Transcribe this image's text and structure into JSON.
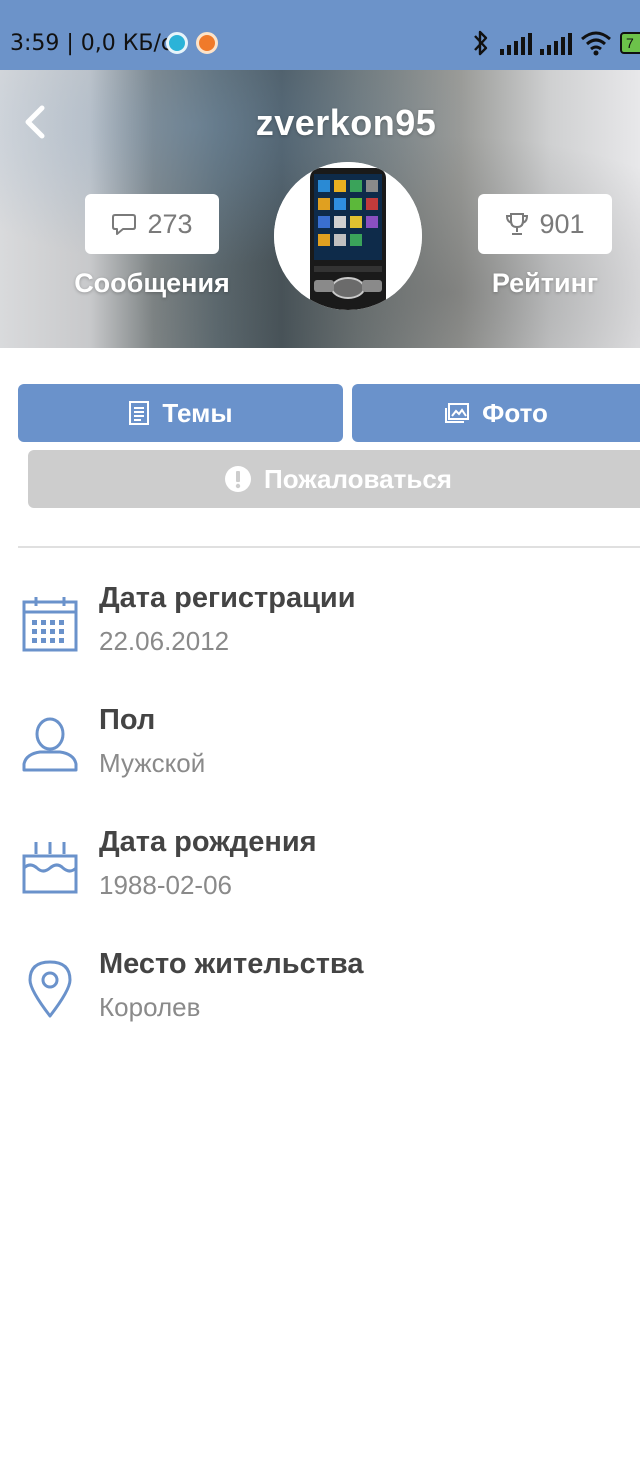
{
  "status_bar": {
    "time_text": "3:59 | 0,0 КБ/с",
    "battery_text": "7"
  },
  "header": {
    "username": "zverkon95",
    "messages_count": "273",
    "messages_label": "Сообщения",
    "rating_count": "901",
    "rating_label": "Рейтинг"
  },
  "actions": {
    "topics_label": "Темы",
    "photo_label": "Фото",
    "report_label": "Пожаловаться"
  },
  "info": [
    {
      "title": "Дата регистрации",
      "value": "22.06.2012",
      "icon": "calendar-icon"
    },
    {
      "title": "Пол",
      "value": "Мужской",
      "icon": "person-icon"
    },
    {
      "title": "Дата рождения",
      "value": "1988-02-06",
      "icon": "birthday-cake-icon"
    },
    {
      "title": "Место жительства",
      "value": "Королев",
      "icon": "location-pin-icon"
    }
  ],
  "colors": {
    "accent": "#6a92cb",
    "status_bar": "#6c93c9",
    "report_button": "#cdcdcd",
    "icon_blue": "#6a92cb"
  }
}
